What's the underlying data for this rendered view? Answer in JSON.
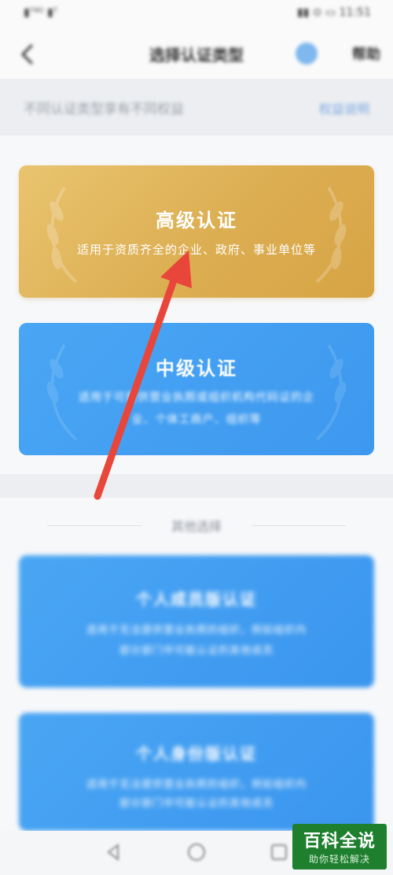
{
  "status_bar": {
    "left": "▮ᵀ⁴ᴳ ▮ᵀ",
    "right": "▮▮ ⊙ ▭ 11:51"
  },
  "nav": {
    "title": "选择认证类型",
    "right_label": "帮助"
  },
  "info_bar": {
    "text": "不同认证类型享有不同权益",
    "link": "权益说明"
  },
  "cards": [
    {
      "title": "高级认证",
      "desc": "适用于资质齐全的企业、政府、事业单位等"
    },
    {
      "title": "中级认证",
      "desc_line1": "适用于可提供营业执照或组织机构代码证的企",
      "desc_line2": "业、个体工商户、组织等"
    }
  ],
  "more": {
    "label": "其他选择",
    "cards": [
      {
        "title": "个人成员版认证",
        "desc_line1": "适用于无法提供营业执照的组织，例如组织内",
        "desc_line2": "部分部门中可能认证的其他成员"
      },
      {
        "title": "个人身份版认证",
        "desc_line1": "适用于无法提供营业执照的组织，例如组织内",
        "desc_line2": "部分部门中可能认证的其他成员"
      }
    ]
  },
  "watermark": {
    "main": "百科全说",
    "sub": "助你轻松解决"
  },
  "colors": {
    "gold": "#dcae52",
    "blue": "#3d98ef",
    "arrow": "#e8463a",
    "watermark": "#1e7f2f"
  }
}
